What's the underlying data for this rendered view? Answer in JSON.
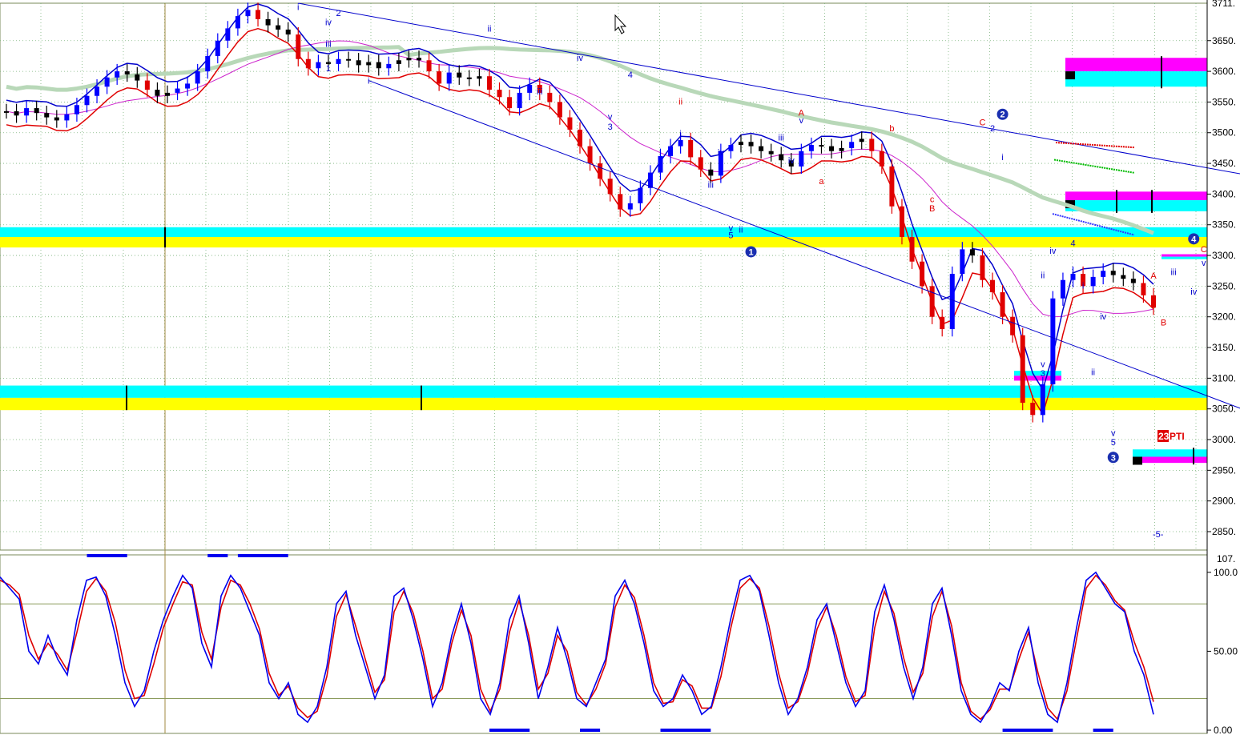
{
  "chart_data": [
    {
      "type": "line",
      "subtype": "candlestick-price-chart",
      "title": "",
      "xlabel": "",
      "ylabel": "",
      "ylim": [
        2820,
        3711
      ],
      "y_ticks": [
        "3650.",
        "3600.",
        "3550.",
        "3500.",
        "3450.",
        "3400.",
        "3350.",
        "3300.",
        "3250.",
        "3200.",
        "3150.",
        "3100.",
        "3050.",
        "3000.",
        "2950.",
        "2900.",
        "2850."
      ],
      "y_tick_values": [
        3650,
        3600,
        3550,
        3500,
        3450,
        3400,
        3350,
        3300,
        3250,
        3200,
        3150,
        3100,
        3050,
        3000,
        2950,
        2900,
        2850
      ],
      "top_tick_label": "3711.",
      "grid": true,
      "series": [
        {
          "role": "price",
          "color_up": "#0000ff",
          "color_down": "#e00000",
          "color_neutral": "#000000",
          "values": [
            3535,
            3528,
            3540,
            3532,
            3525,
            3520,
            3530,
            3545,
            3560,
            3575,
            3590,
            3600,
            3595,
            3585,
            3570,
            3560,
            3565,
            3572,
            3580,
            3600,
            3625,
            3650,
            3670,
            3690,
            3700,
            3685,
            3675,
            3668,
            3660,
            3620,
            3605,
            3615,
            3612,
            3620,
            3618,
            3610,
            3615,
            3605,
            3612,
            3618,
            3622,
            3618,
            3600,
            3580,
            3598,
            3590,
            3588,
            3592,
            3570,
            3558,
            3540,
            3565,
            3578,
            3565,
            3550,
            3525,
            3505,
            3478,
            3450,
            3425,
            3400,
            3375,
            3385,
            3410,
            3435,
            3462,
            3478,
            3488,
            3460,
            3440,
            3430,
            3470,
            3480,
            3485,
            3478,
            3470,
            3465,
            3455,
            3445,
            3470,
            3480,
            3478,
            3470,
            3475,
            3485,
            3490,
            3470,
            3445,
            3380,
            3330,
            3290,
            3250,
            3200,
            3180,
            3270,
            3310,
            3300,
            3260,
            3240,
            3200,
            3170,
            3060,
            3040,
            3090,
            3230,
            3260,
            3270,
            3250,
            3265,
            3275,
            3268,
            3262,
            3255,
            3235,
            3215
          ]
        },
        {
          "role": "upper-band",
          "color": "#0000cc"
        },
        {
          "role": "lower-band",
          "color": "#e00000"
        },
        {
          "role": "moving-average-short",
          "color": "#cc22cc"
        },
        {
          "role": "moving-average-long",
          "color": "#b8d8b8"
        }
      ],
      "support_zones": [
        {
          "top": 3346,
          "mid": 3330,
          "bottom": 3313,
          "colors": [
            "#00ffff",
            "#ffff00"
          ]
        },
        {
          "top": 3088,
          "mid": 3068,
          "bottom": 3048,
          "colors": [
            "#00ffff",
            "#ffff00"
          ]
        }
      ],
      "right_zones": [
        {
          "top": 3622,
          "mid": 3600,
          "bottom": 3575,
          "colors": [
            "#ff00ff",
            "#00ffff"
          ]
        },
        {
          "top": 3404,
          "mid": 3390,
          "bottom": 3372,
          "colors": [
            "#ff00ff",
            "#00ffff"
          ]
        },
        {
          "top": 2984,
          "mid": 2972,
          "bottom": 2962,
          "colors": [
            "#00ffff",
            "#ff00ff"
          ]
        },
        {
          "top": 3302,
          "mid": 3298,
          "bottom": 3294,
          "colors": [
            "#ff00ff",
            "#00ffff"
          ]
        },
        {
          "top": 3112,
          "mid": 3104,
          "bottom": 3096,
          "colors": [
            "#00ffff",
            "#ff00ff"
          ]
        }
      ],
      "trendlines": [
        {
          "from_bar": 29,
          "from_price": 3711,
          "to_bar": 127,
          "to_price": 3420,
          "color": "#0000cc"
        },
        {
          "from_bar": 36,
          "from_price": 3585,
          "to_bar": 127,
          "to_price": 3024,
          "color": "#0000cc"
        }
      ],
      "annotations": [
        {
          "text": "i",
          "bar": 29,
          "price": 3700,
          "color": "#0000cc"
        },
        {
          "text": "2",
          "bar": 33,
          "price": 3690,
          "color": "#0000cc"
        },
        {
          "text": "iv",
          "bar": 32,
          "price": 3675,
          "color": "#0000cc"
        },
        {
          "text": "iii",
          "bar": 32,
          "price": 3640,
          "color": "#0000cc"
        },
        {
          "text": "1",
          "bar": 32,
          "price": 3600,
          "color": "#0000cc"
        },
        {
          "text": "i",
          "bar": 36,
          "price": 3580,
          "color": "#0000cc"
        },
        {
          "text": "ii",
          "bar": 48,
          "price": 3665,
          "color": "#0000cc"
        },
        {
          "text": "iv",
          "bar": 57,
          "price": 3617,
          "color": "#0000cc"
        },
        {
          "text": "4",
          "bar": 62,
          "price": 3590,
          "color": "#0000cc"
        },
        {
          "text": "iii",
          "bar": 53,
          "price": 3562,
          "color": "#0000cc"
        },
        {
          "text": "v",
          "bar": 60,
          "price": 3521,
          "color": "#0000cc"
        },
        {
          "text": "3",
          "bar": 60,
          "price": 3505,
          "color": "#0000cc"
        },
        {
          "text": "ii",
          "bar": 67,
          "price": 3546,
          "color": "#e00000"
        },
        {
          "text": "i",
          "bar": 67,
          "price": 3494,
          "color": "#0000cc"
        },
        {
          "text": "iv",
          "bar": 71,
          "price": 3463,
          "color": "#0000cc"
        },
        {
          "text": "iii",
          "bar": 70,
          "price": 3410,
          "color": "#0000cc"
        },
        {
          "text": "v",
          "bar": 72,
          "price": 3340,
          "color": "#0000cc"
        },
        {
          "text": "5",
          "bar": 72,
          "price": 3328,
          "color": "#0000cc"
        },
        {
          "text": "ii",
          "bar": 73,
          "price": 3337,
          "color": "#0000cc"
        },
        {
          "text": "A",
          "bar": 79,
          "price": 3528,
          "color": "#e00000"
        },
        {
          "text": "v",
          "bar": 79,
          "price": 3515,
          "color": "#0000cc"
        },
        {
          "text": "iii",
          "bar": 77,
          "price": 3487,
          "color": "#0000cc"
        },
        {
          "text": "iv",
          "bar": 78,
          "price": 3450,
          "color": "#0000cc"
        },
        {
          "text": "a",
          "bar": 81,
          "price": 3416,
          "color": "#e00000"
        },
        {
          "text": "b",
          "bar": 88,
          "price": 3502,
          "color": "#e00000"
        },
        {
          "text": "c",
          "bar": 92,
          "price": 3387,
          "color": "#e00000"
        },
        {
          "text": "B",
          "bar": 92,
          "price": 3372,
          "color": "#e00000"
        },
        {
          "text": "C",
          "bar": 97,
          "price": 3512,
          "color": "#e00000"
        },
        {
          "text": "2",
          "bar": 98,
          "price": 3502,
          "color": "#0000cc"
        },
        {
          "text": "i",
          "bar": 99,
          "price": 3455,
          "color": "#0000cc"
        },
        {
          "text": "ii",
          "bar": 103,
          "price": 3263,
          "color": "#0000cc"
        },
        {
          "text": "iv",
          "bar": 104,
          "price": 3303,
          "color": "#0000cc"
        },
        {
          "text": "4",
          "bar": 106,
          "price": 3315,
          "color": "#0000cc"
        },
        {
          "text": "i",
          "bar": 107,
          "price": 3246,
          "color": "#0000cc"
        },
        {
          "text": "v",
          "bar": 103,
          "price": 3118,
          "color": "#0000cc"
        },
        {
          "text": "3",
          "bar": 103,
          "price": 3103,
          "color": "#0000cc"
        },
        {
          "text": "iv",
          "bar": 109,
          "price": 3196,
          "color": "#0000cc"
        },
        {
          "text": "ii",
          "bar": 108,
          "price": 3105,
          "color": "#0000cc"
        },
        {
          "text": "v",
          "bar": 110,
          "price": 3006,
          "color": "#0000cc"
        },
        {
          "text": "5",
          "bar": 110,
          "price": 2991,
          "color": "#0000cc"
        },
        {
          "text": "A",
          "bar": 114,
          "price": 3262,
          "color": "#e00000"
        },
        {
          "text": "iii",
          "bar": 116,
          "price": 3268,
          "color": "#0000cc"
        },
        {
          "text": "iv",
          "bar": 118,
          "price": 3236,
          "color": "#0000cc"
        },
        {
          "text": "B",
          "bar": 115,
          "price": 3186,
          "color": "#e00000"
        },
        {
          "text": "C",
          "bar": 119,
          "price": 3305,
          "color": "#e00000"
        },
        {
          "text": "v",
          "bar": 119,
          "price": 3283,
          "color": "#0000cc"
        }
      ],
      "wave_markers": [
        {
          "text": "1",
          "bar": 74,
          "price": 3306
        },
        {
          "text": "2",
          "bar": 99,
          "price": 3530
        },
        {
          "text": "3",
          "bar": 110,
          "price": 2971
        },
        {
          "text": "4",
          "bar": 118,
          "price": 3327
        }
      ],
      "pti_label": {
        "number": "23",
        "text": "PTI"
      },
      "corner_label": "-5-"
    },
    {
      "type": "line",
      "subtype": "stochastic-oscillator",
      "title": "",
      "ylim": [
        0,
        107
      ],
      "y_ticks": [
        "100.0",
        "50.00",
        "0.00"
      ],
      "y_tick_values": [
        100,
        50,
        0
      ],
      "top_tick_label": "107.",
      "reference_levels": [
        80,
        20
      ],
      "grid": false,
      "series": [
        {
          "role": "%K",
          "color": "#0000ee",
          "values": [
            97,
            90,
            83,
            50,
            42,
            60,
            45,
            35,
            70,
            95,
            97,
            85,
            60,
            30,
            15,
            25,
            50,
            70,
            85,
            98,
            90,
            55,
            40,
            85,
            98,
            90,
            75,
            60,
            30,
            20,
            30,
            10,
            5,
            15,
            40,
            80,
            88,
            60,
            40,
            20,
            35,
            85,
            90,
            70,
            45,
            15,
            30,
            60,
            80,
            55,
            20,
            10,
            30,
            70,
            85,
            55,
            20,
            40,
            65,
            45,
            20,
            15,
            30,
            45,
            85,
            95,
            80,
            55,
            25,
            15,
            20,
            35,
            25,
            10,
            15,
            40,
            70,
            95,
            98,
            88,
            60,
            30,
            10,
            20,
            40,
            70,
            80,
            55,
            30,
            15,
            25,
            75,
            92,
            70,
            40,
            20,
            40,
            80,
            90,
            60,
            25,
            10,
            5,
            15,
            30,
            25,
            50,
            65,
            30,
            10,
            5,
            30,
            65,
            95,
            100,
            90,
            80,
            75,
            50,
            35,
            10
          ]
        },
        {
          "role": "%D",
          "color": "#dd0000",
          "values": [
            95,
            92,
            86,
            60,
            45,
            55,
            48,
            38,
            62,
            88,
            96,
            88,
            68,
            38,
            20,
            22,
            42,
            65,
            80,
            94,
            92,
            62,
            45,
            78,
            95,
            92,
            80,
            64,
            36,
            22,
            28,
            14,
            8,
            12,
            34,
            72,
            86,
            66,
            45,
            24,
            32,
            75,
            88,
            74,
            50,
            20,
            26,
            55,
            76,
            60,
            26,
            12,
            26,
            62,
            82,
            60,
            26,
            36,
            60,
            50,
            24,
            16,
            26,
            42,
            78,
            92,
            84,
            60,
            30,
            17,
            18,
            32,
            28,
            14,
            14,
            34,
            64,
            90,
            96,
            90,
            66,
            36,
            14,
            18,
            36,
            64,
            78,
            60,
            34,
            18,
            22,
            65,
            88,
            74,
            46,
            24,
            36,
            72,
            88,
            66,
            30,
            12,
            7,
            13,
            26,
            26,
            45,
            62,
            36,
            14,
            7,
            25,
            58,
            90,
            98,
            92,
            82,
            76,
            56,
            40,
            18
          ]
        }
      ],
      "highlight_bars_top": [
        {
          "from": 8,
          "to": 12
        },
        {
          "from": 20,
          "to": 22
        },
        {
          "from": 23,
          "to": 28
        }
      ],
      "highlight_bars_bottom": [
        {
          "from": 48,
          "to": 52
        },
        {
          "from": 57,
          "to": 59
        },
        {
          "from": 65,
          "to": 70
        },
        {
          "from": 99,
          "to": 104
        },
        {
          "from": 108,
          "to": 110
        }
      ]
    }
  ]
}
